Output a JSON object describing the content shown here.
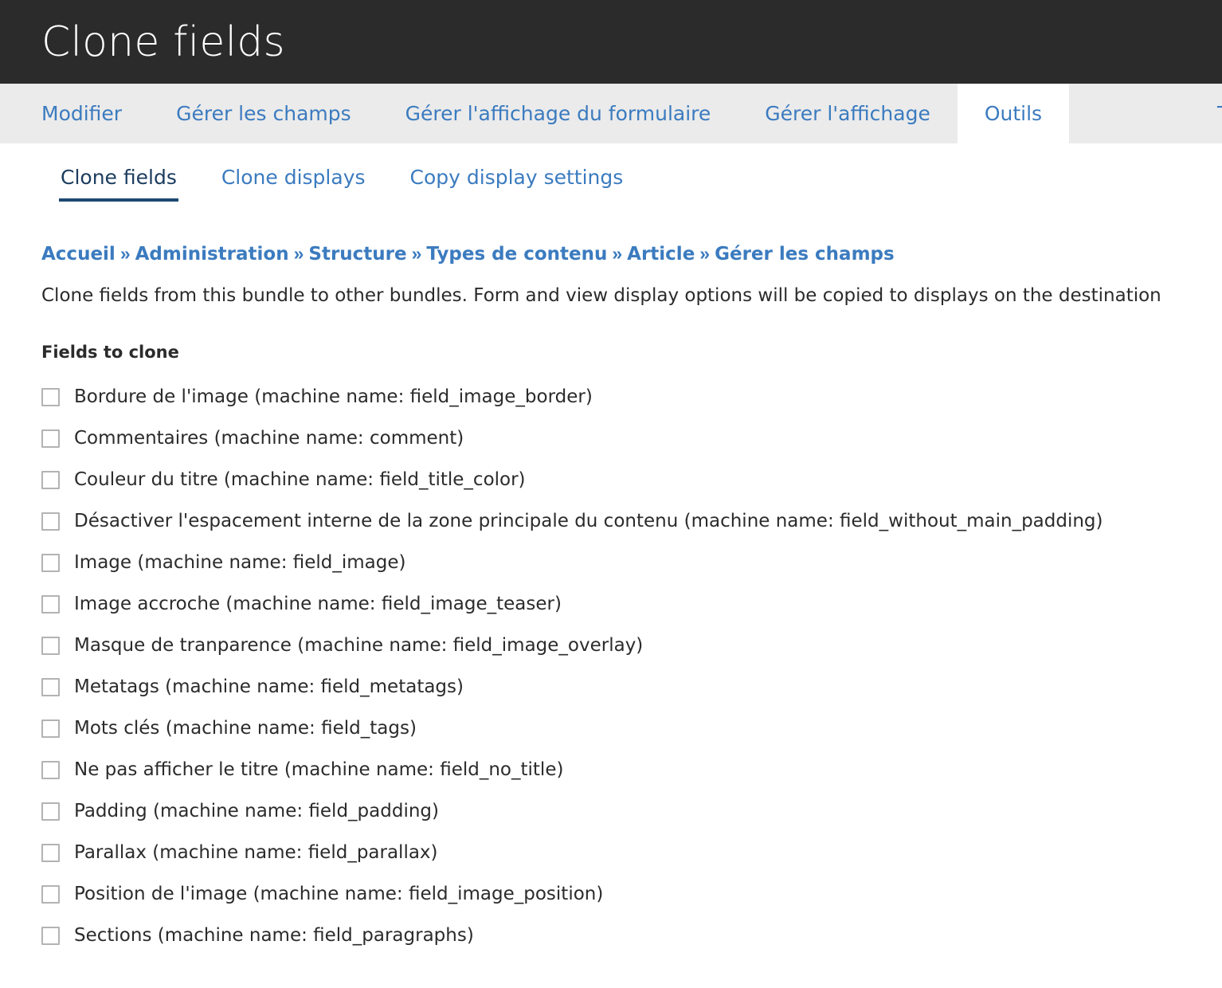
{
  "header": {
    "title": "Clone fields",
    "bg_color": "#2b2b2b"
  },
  "primary_tabs": {
    "items": [
      {
        "label": "Modifier",
        "active": false
      },
      {
        "label": "Gérer les champs",
        "active": false
      },
      {
        "label": "Gérer l'affichage du formulaire",
        "active": false
      },
      {
        "label": "Gérer l'affichage",
        "active": false
      },
      {
        "label": "Outils",
        "active": true
      }
    ],
    "cutoff_label": "T",
    "link_color": "#3b7bbf",
    "bar_color": "#ebebeb"
  },
  "secondary_tabs": {
    "items": [
      {
        "label": "Clone fields",
        "active": true
      },
      {
        "label": "Clone displays",
        "active": false
      },
      {
        "label": "Copy display settings",
        "active": false
      }
    ],
    "active_underline_color": "#1d4870"
  },
  "breadcrumb": {
    "separator": "»",
    "items": [
      "Accueil",
      "Administration",
      "Structure",
      "Types de contenu",
      "Article",
      "Gérer les champs"
    ]
  },
  "description": "Clone fields from this bundle to other bundles. Form and view display options will be copied to displays on the destination",
  "fields_section": {
    "legend": "Fields to clone",
    "fields": [
      {
        "label": "Bordure de l'image (machine name: field_image_border)",
        "checked": false
      },
      {
        "label": "Commentaires (machine name: comment)",
        "checked": false
      },
      {
        "label": "Couleur du titre (machine name: field_title_color)",
        "checked": false
      },
      {
        "label": "Désactiver l'espacement interne de la zone principale du contenu (machine name: field_without_main_padding)",
        "checked": false
      },
      {
        "label": "Image (machine name: field_image)",
        "checked": false
      },
      {
        "label": "Image accroche (machine name: field_image_teaser)",
        "checked": false
      },
      {
        "label": "Masque de tranparence (machine name: field_image_overlay)",
        "checked": false
      },
      {
        "label": "Metatags (machine name: field_metatags)",
        "checked": false
      },
      {
        "label": "Mots clés (machine name: field_tags)",
        "checked": false
      },
      {
        "label": "Ne pas afficher le titre (machine name: field_no_title)",
        "checked": false
      },
      {
        "label": "Padding (machine name: field_padding)",
        "checked": false
      },
      {
        "label": "Parallax (machine name: field_parallax)",
        "checked": false
      },
      {
        "label": "Position de l'image (machine name: field_image_position)",
        "checked": false
      },
      {
        "label": "Sections (machine name: field_paragraphs)",
        "checked": false
      }
    ]
  }
}
